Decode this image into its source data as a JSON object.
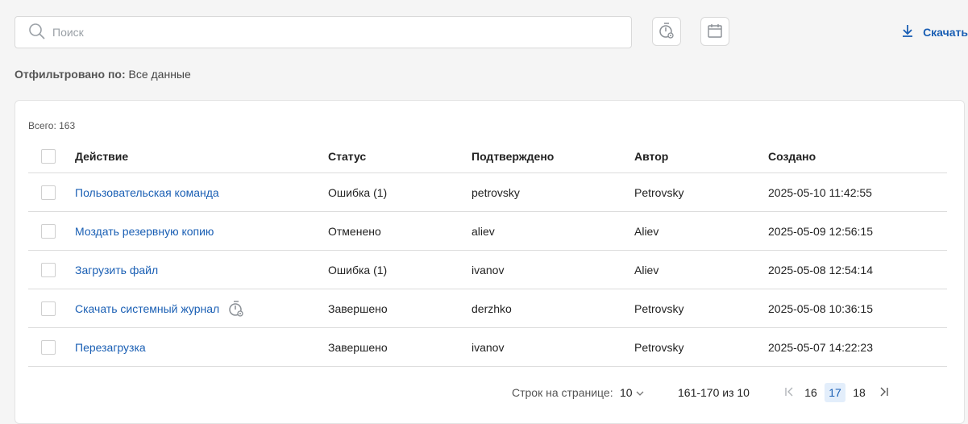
{
  "search": {
    "placeholder": "Поиск",
    "value": ""
  },
  "toolbar": {
    "download_label": "Скачать",
    "timer_icon": "timer-settings-icon",
    "calendar_icon": "calendar-icon",
    "download_icon": "download-icon"
  },
  "filter": {
    "label": "Отфильтровано по:",
    "value": "Все данные"
  },
  "table": {
    "total": "Всего: 163",
    "columns": [
      "Действие",
      "Статус",
      "Подтверждено",
      "Автор",
      "Создано"
    ],
    "rows": [
      {
        "action": "Пользовательская команда",
        "status": "Ошибка (1)",
        "confirmed": "petrovsky",
        "author": "Petrovsky",
        "created": "2025-05-10 11:42:55",
        "scheduled": false
      },
      {
        "action": "Моздать резервную копию",
        "status": "Отменено",
        "confirmed": "aliev",
        "author": "Aliev",
        "created": "2025-05-09 12:56:15",
        "scheduled": false
      },
      {
        "action": "Загрузить файл",
        "status": "Ошибка (1)",
        "confirmed": "ivanov",
        "author": "Aliev",
        "created": "2025-05-08 12:54:14",
        "scheduled": false
      },
      {
        "action": "Скачать системный журнал",
        "status": "Завершено",
        "confirmed": "derzhko",
        "author": "Petrovsky",
        "created": "2025-05-08 10:36:15",
        "scheduled": true
      },
      {
        "action": "Перезагрузка",
        "status": "Завершено",
        "confirmed": "ivanov",
        "author": "Petrovsky",
        "created": "2025-05-07 14:22:23",
        "scheduled": false
      }
    ]
  },
  "pagination": {
    "rows_per_page_label": "Строк на странице:",
    "rows_per_page_value": "10",
    "range": "161-170 из 10",
    "pages": [
      "16",
      "17",
      "18"
    ],
    "current_page": "17",
    "first_icon": "first-page-icon",
    "last_icon": "last-page-icon"
  },
  "colors": {
    "link": "#1a5fb4",
    "active_page_bg": "#e3eefb"
  }
}
